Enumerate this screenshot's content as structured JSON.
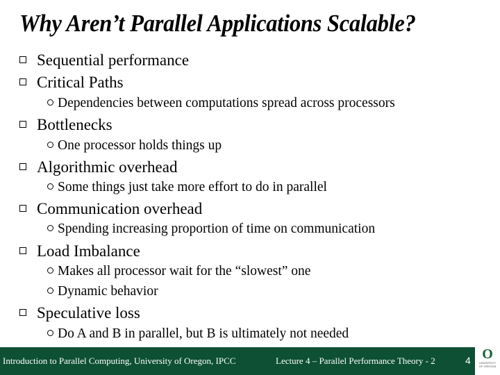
{
  "slide": {
    "title": "Why Aren’t Parallel Applications Scalable?",
    "bullets": [
      {
        "text": "Sequential performance",
        "sub": []
      },
      {
        "text": "Critical Paths",
        "sub": [
          "Dependencies between computations spread across processors"
        ]
      },
      {
        "text": "Bottlenecks",
        "sub": [
          "One processor holds things up"
        ]
      },
      {
        "text": "Algorithmic overhead",
        "sub": [
          "Some things just take more effort to do in parallel"
        ]
      },
      {
        "text": "Communication overhead",
        "sub": [
          "Spending increasing proportion of time on communication"
        ]
      },
      {
        "text": "Load Imbalance",
        "sub": [
          "Makes all processor wait for the “slowest” one",
          "Dynamic behavior"
        ]
      },
      {
        "text": "Speculative loss",
        "sub": [
          "Do A and B in parallel, but B is ultimately not needed"
        ]
      }
    ]
  },
  "footer": {
    "course": "Introduction to Parallel Computing, University of Oregon, IPCC",
    "lecture": "Lecture 4 – Parallel Performance Theory - 2",
    "page_number": "4",
    "logo_letter": "O",
    "logo_line1": "UNIVERSITY",
    "logo_line2": "OF OREGON",
    "background_color": "#0d5034"
  }
}
